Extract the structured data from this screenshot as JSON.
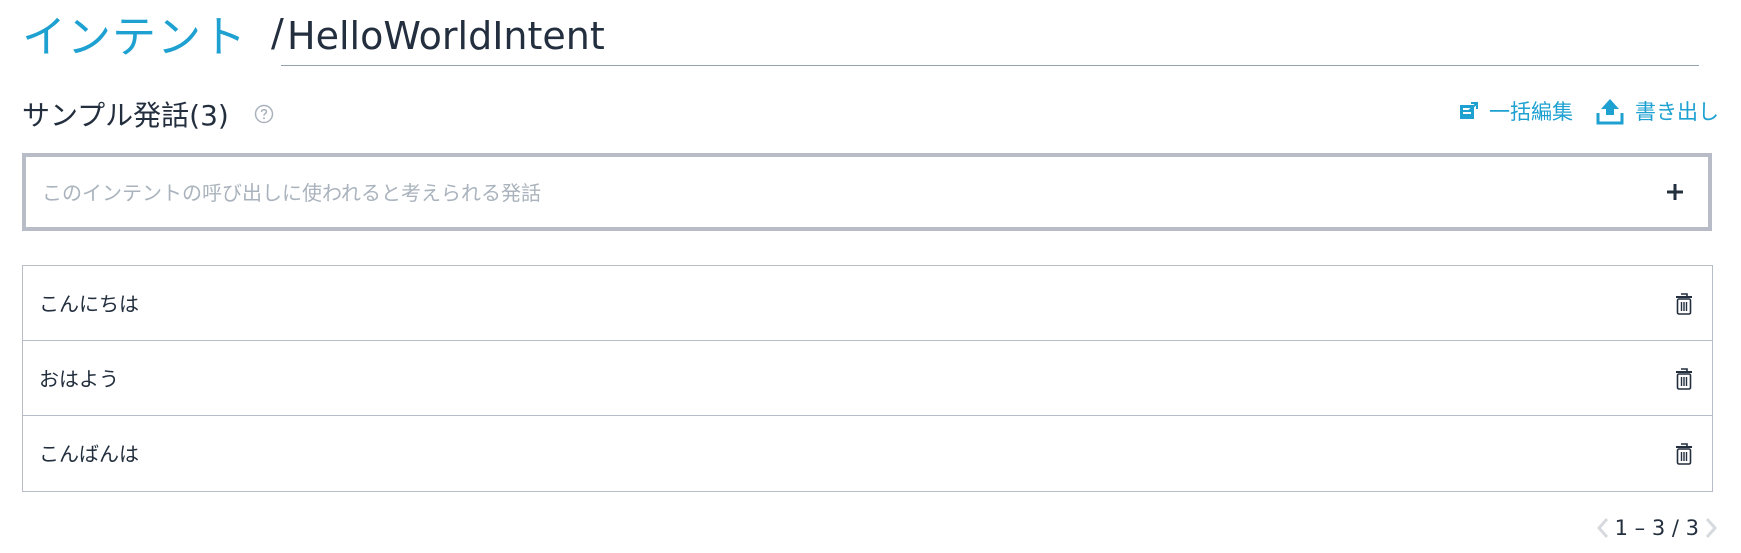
{
  "breadcrumb": {
    "parent_label": "インテント",
    "separator": "/",
    "intent_name": "HelloWorldIntent"
  },
  "section": {
    "title": "サンプル発話(3)",
    "help_icon": "question-circle-icon"
  },
  "actions": {
    "bulk_edit_label": "一括編集",
    "bulk_edit_icon": "bulk-edit-icon",
    "export_label": "書き出し",
    "export_icon": "upload-icon"
  },
  "add_utterance": {
    "placeholder": "このインテントの呼び出しに使われると考えられる発話",
    "value": "",
    "add_icon": "plus-icon"
  },
  "utterances": [
    {
      "text": "こんにちは"
    },
    {
      "text": "おはよう"
    },
    {
      "text": "こんばんは"
    }
  ],
  "pagination": {
    "range": "1 – 3 / 3"
  },
  "colors": {
    "accent": "#1ea1d1",
    "text": "#232f3e",
    "border": "#b8bcc7",
    "placeholder": "#aab3bd"
  }
}
